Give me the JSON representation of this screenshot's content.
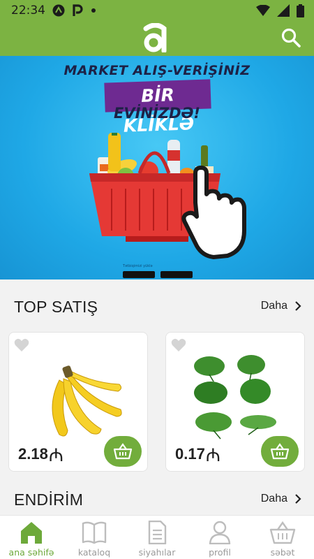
{
  "status_bar": {
    "time": "22:34",
    "icons": [
      "arrow-icon",
      "parking-icon",
      "dot-icon",
      "wifi-icon",
      "signal-icon",
      "battery-icon"
    ]
  },
  "app_bar": {
    "logo_letter": "a",
    "icons": [
      "search-icon"
    ]
  },
  "banner": {
    "line1": "MARKET ALIŞ-VERİŞİNİZ",
    "line2": "BİR KLİKLƏ",
    "line3": "EVİNİZDƏ!",
    "caption": "Tətbiqimizi yüklə",
    "slide_index": 2,
    "slide_count": 2
  },
  "top_sales": {
    "title": "TOP SATIŞ",
    "more_label": "Daha",
    "products": [
      {
        "price": "2.18",
        "currency_symbol": "₼",
        "image": "banana-image"
      },
      {
        "price": "0.17",
        "currency_symbol": "₼",
        "image": "greens-image"
      }
    ]
  },
  "discount": {
    "title": "ENDİRİM",
    "more_label": "Daha"
  },
  "bottom_nav": {
    "items": [
      {
        "label": "ana səhifə",
        "icon": "home-icon",
        "active": true
      },
      {
        "label": "kataloq",
        "icon": "book-icon",
        "active": false
      },
      {
        "label": "siyahılar",
        "icon": "list-icon",
        "active": false
      },
      {
        "label": "profil",
        "icon": "profile-icon",
        "active": false
      },
      {
        "label": "səbət",
        "icon": "basket-icon",
        "active": false
      }
    ]
  },
  "colors": {
    "brand_green": "#7cb342",
    "button_green": "#72ad3c",
    "active_nav": "#6da93a",
    "banner_blue": "#1fa8e6",
    "banner_purple": "#6e2a91"
  }
}
